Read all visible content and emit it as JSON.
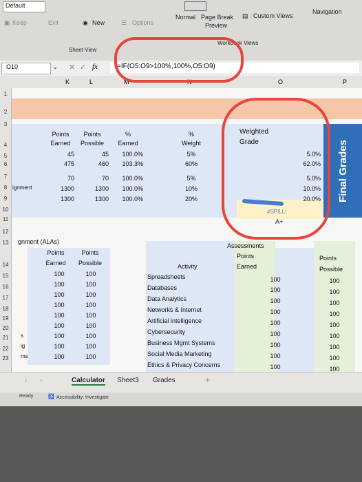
{
  "ribbon": {
    "default_label": "Default",
    "keep_label": "Keep",
    "exit_label": "Exit",
    "new_label": "New",
    "options_label": "Options",
    "sheet_view_label": "Sheet View",
    "normal_label": "Normal",
    "page_break_label": "Page Break",
    "preview_label": "Preview",
    "custom_views_label": "Custom Views",
    "navigation_label": "Navigation",
    "workbook_views_label": "Workbook Views"
  },
  "formula_bar": {
    "name_box": "O10",
    "fx": "fx",
    "formula": "=IF(O5:O9>100%,100%,O5:O9)"
  },
  "column_headers": [
    "K",
    "L",
    "M",
    "N",
    "O",
    "P"
  ],
  "row_numbers": [
    "1",
    "2",
    "3",
    "4",
    "5",
    "6",
    "7",
    "8",
    "9",
    "10",
    "11",
    "12",
    "13",
    "14",
    "15",
    "16",
    "17",
    "18",
    "19",
    "20",
    "21",
    "22",
    "23"
  ],
  "table1": {
    "headers": {
      "points_earned": [
        "Points",
        "Earned"
      ],
      "points_possible": [
        "Points",
        "Possible"
      ],
      "pct_earned": [
        "%",
        "Earned"
      ],
      "weight": [
        "%",
        "Weight"
      ],
      "weighted_grade": [
        "Weighted",
        "Grade"
      ]
    },
    "row_label_8": "ignment",
    "rows": [
      {
        "earned": "45",
        "possible": "45",
        "pct": "100.0%",
        "weight": "5%",
        "grade": "5.0%"
      },
      {
        "earned": "475",
        "possible": "460",
        "pct": "103.3%",
        "weight": "60%",
        "grade": "62.0%"
      },
      {
        "earned": "70",
        "possible": "70",
        "pct": "100.0%",
        "weight": "5%",
        "grade": "5.0%"
      },
      {
        "earned": "1300",
        "possible": "1300",
        "pct": "100.0%",
        "weight": "10%",
        "grade": "10.0%"
      },
      {
        "earned": "1300",
        "possible": "1300",
        "pct": "100.0%",
        "weight": "20%",
        "grade": "20.0%"
      }
    ],
    "spill_error": "#SPILL!",
    "letter_grade": "A+",
    "final_grades_label": "Final Grades"
  },
  "table2": {
    "title": "gnment (ALAs)",
    "headers": {
      "points_earned": [
        "Points",
        "Earned"
      ],
      "points_possible": [
        "Points",
        "Possible"
      ]
    },
    "row_stubs": [
      "",
      "",
      "",
      "",
      "",
      "",
      "s",
      "ig",
      "ms"
    ],
    "rows": [
      [
        "100",
        "100"
      ],
      [
        "100",
        "100"
      ],
      [
        "100",
        "100"
      ],
      [
        "100",
        "100"
      ],
      [
        "100",
        "100"
      ],
      [
        "100",
        "100"
      ],
      [
        "100",
        "100"
      ],
      [
        "100",
        "100"
      ],
      [
        "100",
        "100"
      ]
    ]
  },
  "table3": {
    "title": "Assessments",
    "activity_header": "Activity",
    "points_earned": [
      "Points",
      "Earned"
    ],
    "points_possible": [
      "Points",
      "Possible"
    ],
    "rows": [
      {
        "activity": "Spreadsheets",
        "earned": "100",
        "possible": "100"
      },
      {
        "activity": "Databases",
        "earned": "100",
        "possible": "100"
      },
      {
        "activity": "Data Analytics",
        "earned": "100",
        "possible": "100"
      },
      {
        "activity": "Networks & Internet",
        "earned": "100",
        "possible": "100"
      },
      {
        "activity": "Artificial intelligence",
        "earned": "100",
        "possible": "100"
      },
      {
        "activity": "Cybersecurity",
        "earned": "100",
        "possible": "100"
      },
      {
        "activity": "Business Mgmt Systems",
        "earned": "100",
        "possible": "100"
      },
      {
        "activity": "Social Media Marketing",
        "earned": "100",
        "possible": "100"
      },
      {
        "activity": "Ethics & Privacy Concerns",
        "earned": "100",
        "possible": "100"
      }
    ]
  },
  "sheet_tabs": [
    "Calculator",
    "Sheet3",
    "Grades"
  ],
  "add_sheet": "+",
  "status": {
    "ready": "Ready",
    "accessibility": "Accessibility: Investigate"
  },
  "colors": {
    "spill_blue": "#4a78d8",
    "annotation_red": "#e8453c",
    "header_peach": "#f6c6a8",
    "table_blue": "#dde7f6"
  }
}
